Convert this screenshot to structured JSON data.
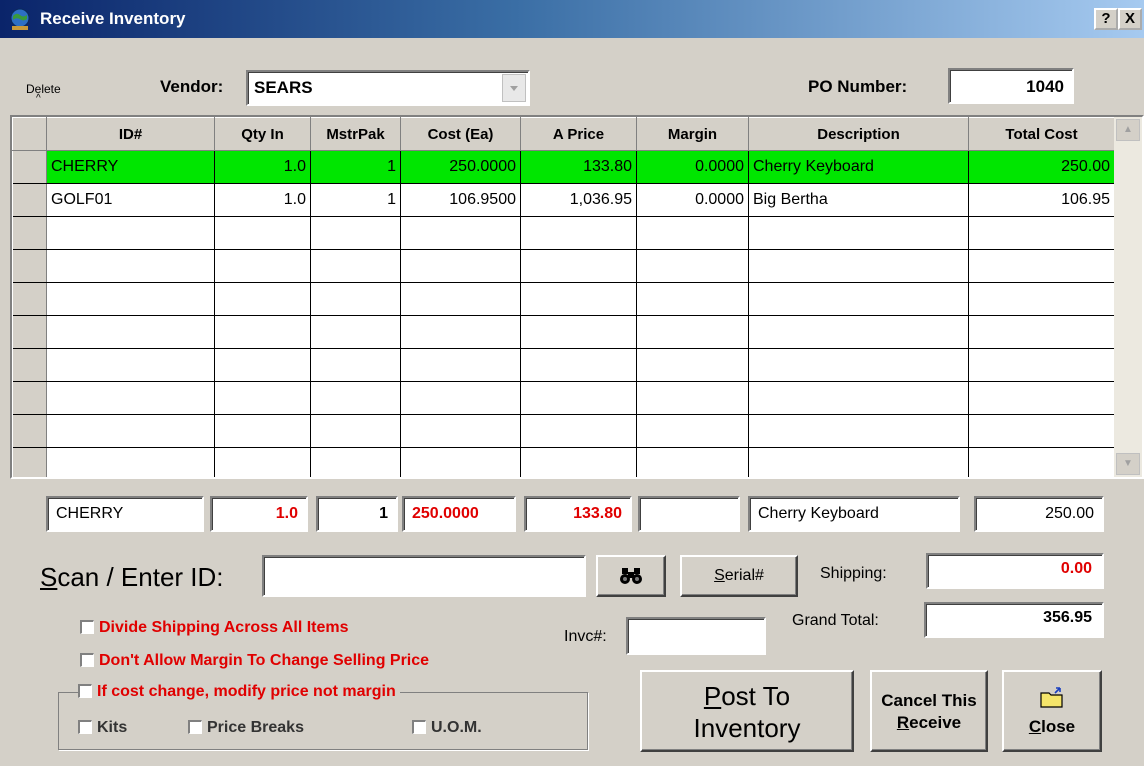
{
  "window": {
    "title": "Receive Inventory",
    "help_label": "?",
    "close_label": "X"
  },
  "header": {
    "delete_label": "Delete",
    "delete_caret": "^",
    "vendor_label": "Vendor:",
    "vendor_value": "SEARS",
    "po_label": "PO Number:",
    "po_value": "1040"
  },
  "grid": {
    "columns": [
      "ID#",
      "Qty In",
      "MstrPak",
      "Cost (Ea)",
      "A Price",
      "Margin",
      "Description",
      "Total Cost"
    ],
    "rows": [
      {
        "id": "CHERRY",
        "qty": "1.0",
        "mstrpak": "1",
        "cost": "250.0000",
        "aprice": "133.80",
        "margin": "0.0000",
        "description": "Cherry Keyboard",
        "total": "250.00",
        "highlight": true
      },
      {
        "id": "GOLF01",
        "qty": "1.0",
        "mstrpak": "1",
        "cost": "106.9500",
        "aprice": "1,036.95",
        "margin": "0.0000",
        "description": "Big Bertha",
        "total": "106.95",
        "highlight": false
      }
    ],
    "empty_rows": 8
  },
  "entry": {
    "id": "CHERRY",
    "qty": "1.0",
    "mstrpak": "1",
    "cost": "250.0000",
    "aprice": "133.80",
    "margin": "",
    "description": "Cherry Keyboard",
    "total": "250.00"
  },
  "scan": {
    "label": "Scan / Enter ID:",
    "value": "",
    "serial_label": "Serial#"
  },
  "totals": {
    "shipping_label": "Shipping:",
    "shipping_value": "0.00",
    "grand_total_label": "Grand Total:",
    "grand_total_value": "356.95",
    "invc_label": "Invc#:",
    "invc_value": ""
  },
  "options": {
    "divide_shipping": "Divide Shipping Across All Items",
    "no_margin_change": "Don't Allow Margin To Change Selling Price",
    "cost_change": "If cost change, modify price not margin",
    "kits": "Kits",
    "price_breaks": "Price Breaks",
    "uom": "U.O.M."
  },
  "buttons": {
    "post_line1": "Post To",
    "post_line2": "Inventory",
    "cancel_line1": "Cancel This",
    "cancel_line2": "Receive",
    "close": "Close"
  },
  "colors": {
    "highlight_row": "#00e600",
    "red_text": "#e00000",
    "titlebar": "#0a246a"
  },
  "icons": [
    "app-globe-icon",
    "binoculars-icon",
    "folder-exit-icon",
    "dropdown-arrow-icon",
    "scroll-up-icon",
    "scroll-down-icon"
  ]
}
